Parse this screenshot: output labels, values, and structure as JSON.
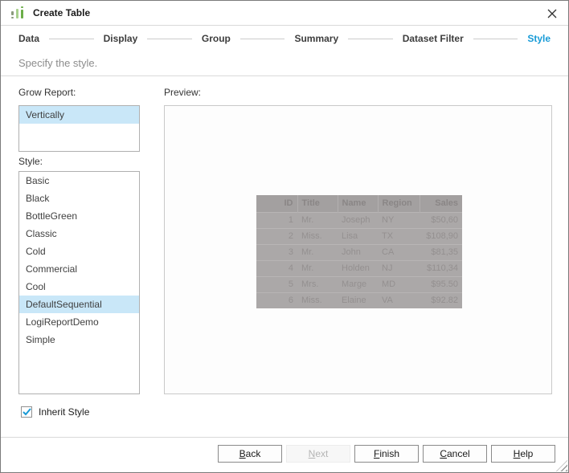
{
  "dialog": {
    "title": "Create Table"
  },
  "steps": [
    {
      "label": "Data"
    },
    {
      "label": "Display"
    },
    {
      "label": "Group"
    },
    {
      "label": "Summary"
    },
    {
      "label": "Dataset Filter"
    },
    {
      "label": "Style",
      "active": true
    }
  ],
  "subtitle": "Specify the style.",
  "grow_report": {
    "label": "Grow Report:",
    "options": [
      "Vertically"
    ],
    "selected": "Vertically"
  },
  "style_list": {
    "label": "Style:",
    "options": [
      "Basic",
      "Black",
      "BottleGreen",
      "Classic",
      "Cold",
      "Commercial",
      "Cool",
      "DefaultSequential",
      "LogiReportDemo",
      "Simple"
    ],
    "selected": "DefaultSequential"
  },
  "preview": {
    "label": "Preview:",
    "table": {
      "columns": [
        "ID",
        "Title",
        "Name",
        "Region",
        "Sales"
      ],
      "rows": [
        [
          "1",
          "Mr.",
          "Joseph",
          "NY",
          "$50,60"
        ],
        [
          "2",
          "Miss.",
          "Lisa",
          "TX",
          "$108,90"
        ],
        [
          "3",
          "Mr.",
          "John",
          "CA",
          "$81,35"
        ],
        [
          "4",
          "Mr.",
          "Holden",
          "NJ",
          "$110,34"
        ],
        [
          "5",
          "Mrs.",
          "Marge",
          "MD",
          "$95.50"
        ],
        [
          "6",
          "Miss.",
          "Elaine",
          "VA",
          "$92.82"
        ]
      ]
    }
  },
  "inherit_style": {
    "label": "Inherit Style",
    "checked": true
  },
  "buttons": {
    "back": "Back",
    "next": "Next",
    "next_enabled": false,
    "finish": "Finish",
    "cancel": "Cancel",
    "help": "Help"
  },
  "colors": {
    "accent_blue": "#189bd7",
    "selection_bg": "#c9e7f8",
    "preview_table_header_bg": "#a3a0a0",
    "preview_table_body_bg": "#aba8a8"
  }
}
